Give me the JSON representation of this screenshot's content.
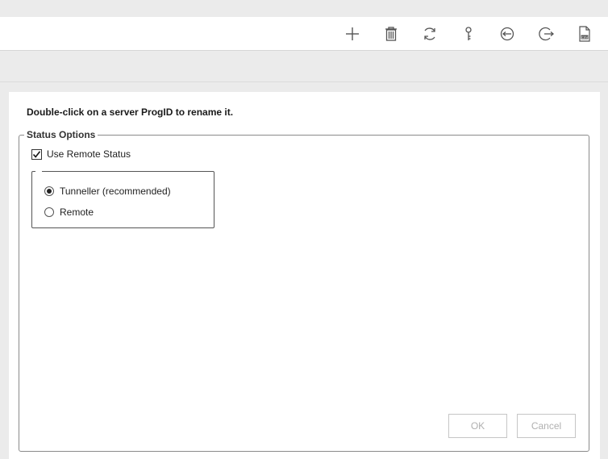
{
  "toolbar": {
    "icons": [
      {
        "name": "add-icon"
      },
      {
        "name": "delete-icon"
      },
      {
        "name": "refresh-icon"
      },
      {
        "name": "key-icon"
      },
      {
        "name": "import-icon"
      },
      {
        "name": "export-icon"
      },
      {
        "name": "csv-file-icon",
        "label": "CSV"
      }
    ]
  },
  "dialog": {
    "instruction": "Double-click on a server ProgID to rename it.",
    "status_group": {
      "legend": "Status Options",
      "use_remote_status": {
        "label": "Use Remote Status",
        "checked": true
      },
      "modes": [
        {
          "label": "Tunneller (recommended)",
          "selected": true
        },
        {
          "label": "Remote",
          "selected": false
        }
      ]
    },
    "buttons": {
      "ok": "OK",
      "cancel": "Cancel"
    }
  },
  "colors": {
    "background": "#ebebeb",
    "panel": "#ffffff",
    "icon": "#555555",
    "disabled_text": "#b0b0b0"
  }
}
